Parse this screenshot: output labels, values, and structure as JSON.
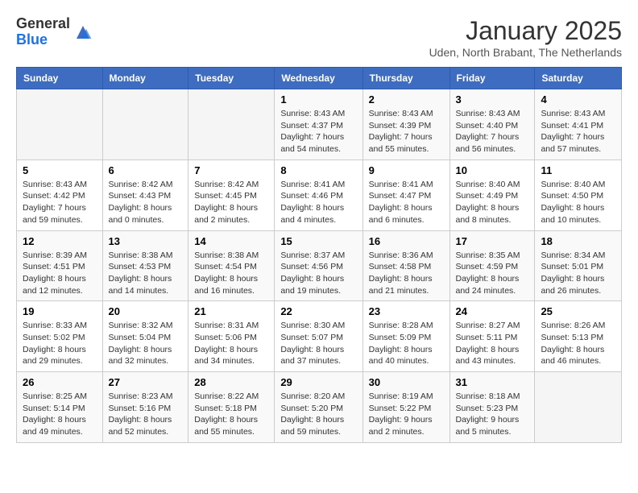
{
  "header": {
    "logo_general": "General",
    "logo_blue": "Blue",
    "month_title": "January 2025",
    "location": "Uden, North Brabant, The Netherlands"
  },
  "days_of_week": [
    "Sunday",
    "Monday",
    "Tuesday",
    "Wednesday",
    "Thursday",
    "Friday",
    "Saturday"
  ],
  "weeks": [
    [
      {
        "day": "",
        "info": ""
      },
      {
        "day": "",
        "info": ""
      },
      {
        "day": "",
        "info": ""
      },
      {
        "day": "1",
        "info": "Sunrise: 8:43 AM\nSunset: 4:37 PM\nDaylight: 7 hours\nand 54 minutes."
      },
      {
        "day": "2",
        "info": "Sunrise: 8:43 AM\nSunset: 4:39 PM\nDaylight: 7 hours\nand 55 minutes."
      },
      {
        "day": "3",
        "info": "Sunrise: 8:43 AM\nSunset: 4:40 PM\nDaylight: 7 hours\nand 56 minutes."
      },
      {
        "day": "4",
        "info": "Sunrise: 8:43 AM\nSunset: 4:41 PM\nDaylight: 7 hours\nand 57 minutes."
      }
    ],
    [
      {
        "day": "5",
        "info": "Sunrise: 8:43 AM\nSunset: 4:42 PM\nDaylight: 7 hours\nand 59 minutes."
      },
      {
        "day": "6",
        "info": "Sunrise: 8:42 AM\nSunset: 4:43 PM\nDaylight: 8 hours\nand 0 minutes."
      },
      {
        "day": "7",
        "info": "Sunrise: 8:42 AM\nSunset: 4:45 PM\nDaylight: 8 hours\nand 2 minutes."
      },
      {
        "day": "8",
        "info": "Sunrise: 8:41 AM\nSunset: 4:46 PM\nDaylight: 8 hours\nand 4 minutes."
      },
      {
        "day": "9",
        "info": "Sunrise: 8:41 AM\nSunset: 4:47 PM\nDaylight: 8 hours\nand 6 minutes."
      },
      {
        "day": "10",
        "info": "Sunrise: 8:40 AM\nSunset: 4:49 PM\nDaylight: 8 hours\nand 8 minutes."
      },
      {
        "day": "11",
        "info": "Sunrise: 8:40 AM\nSunset: 4:50 PM\nDaylight: 8 hours\nand 10 minutes."
      }
    ],
    [
      {
        "day": "12",
        "info": "Sunrise: 8:39 AM\nSunset: 4:51 PM\nDaylight: 8 hours\nand 12 minutes."
      },
      {
        "day": "13",
        "info": "Sunrise: 8:38 AM\nSunset: 4:53 PM\nDaylight: 8 hours\nand 14 minutes."
      },
      {
        "day": "14",
        "info": "Sunrise: 8:38 AM\nSunset: 4:54 PM\nDaylight: 8 hours\nand 16 minutes."
      },
      {
        "day": "15",
        "info": "Sunrise: 8:37 AM\nSunset: 4:56 PM\nDaylight: 8 hours\nand 19 minutes."
      },
      {
        "day": "16",
        "info": "Sunrise: 8:36 AM\nSunset: 4:58 PM\nDaylight: 8 hours\nand 21 minutes."
      },
      {
        "day": "17",
        "info": "Sunrise: 8:35 AM\nSunset: 4:59 PM\nDaylight: 8 hours\nand 24 minutes."
      },
      {
        "day": "18",
        "info": "Sunrise: 8:34 AM\nSunset: 5:01 PM\nDaylight: 8 hours\nand 26 minutes."
      }
    ],
    [
      {
        "day": "19",
        "info": "Sunrise: 8:33 AM\nSunset: 5:02 PM\nDaylight: 8 hours\nand 29 minutes."
      },
      {
        "day": "20",
        "info": "Sunrise: 8:32 AM\nSunset: 5:04 PM\nDaylight: 8 hours\nand 32 minutes."
      },
      {
        "day": "21",
        "info": "Sunrise: 8:31 AM\nSunset: 5:06 PM\nDaylight: 8 hours\nand 34 minutes."
      },
      {
        "day": "22",
        "info": "Sunrise: 8:30 AM\nSunset: 5:07 PM\nDaylight: 8 hours\nand 37 minutes."
      },
      {
        "day": "23",
        "info": "Sunrise: 8:28 AM\nSunset: 5:09 PM\nDaylight: 8 hours\nand 40 minutes."
      },
      {
        "day": "24",
        "info": "Sunrise: 8:27 AM\nSunset: 5:11 PM\nDaylight: 8 hours\nand 43 minutes."
      },
      {
        "day": "25",
        "info": "Sunrise: 8:26 AM\nSunset: 5:13 PM\nDaylight: 8 hours\nand 46 minutes."
      }
    ],
    [
      {
        "day": "26",
        "info": "Sunrise: 8:25 AM\nSunset: 5:14 PM\nDaylight: 8 hours\nand 49 minutes."
      },
      {
        "day": "27",
        "info": "Sunrise: 8:23 AM\nSunset: 5:16 PM\nDaylight: 8 hours\nand 52 minutes."
      },
      {
        "day": "28",
        "info": "Sunrise: 8:22 AM\nSunset: 5:18 PM\nDaylight: 8 hours\nand 55 minutes."
      },
      {
        "day": "29",
        "info": "Sunrise: 8:20 AM\nSunset: 5:20 PM\nDaylight: 8 hours\nand 59 minutes."
      },
      {
        "day": "30",
        "info": "Sunrise: 8:19 AM\nSunset: 5:22 PM\nDaylight: 9 hours\nand 2 minutes."
      },
      {
        "day": "31",
        "info": "Sunrise: 8:18 AM\nSunset: 5:23 PM\nDaylight: 9 hours\nand 5 minutes."
      },
      {
        "day": "",
        "info": ""
      }
    ]
  ]
}
